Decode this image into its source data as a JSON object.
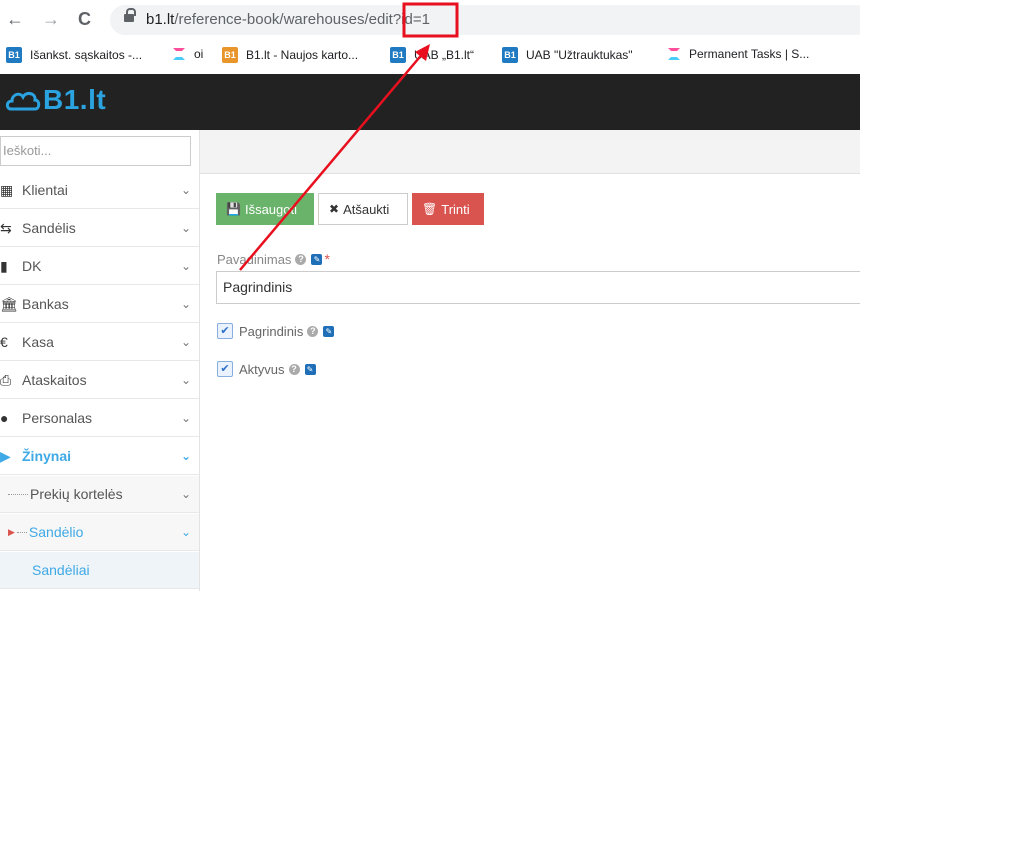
{
  "browser": {
    "back_icon": "←",
    "forward_icon": "→",
    "reload_icon": "C",
    "url_host": "b1.lt",
    "url_path": "/reference-book/warehouses/edit?id=1",
    "bookmarks": [
      {
        "icon": "b1-icon",
        "label": "Išankst. sąskaitos -..."
      },
      {
        "icon": "clickup-icon",
        "label": "oi"
      },
      {
        "icon": "b1-orange-icon",
        "label": "B1.lt - Naujos karto..."
      },
      {
        "icon": "b1-icon",
        "label": "UAB „B1.lt“"
      },
      {
        "icon": "b1-icon",
        "label": "UAB \"Užtrauktukas\""
      },
      {
        "icon": "clickup-icon",
        "label": "Permanent Tasks | S..."
      }
    ],
    "b1_fav_text": "B1"
  },
  "app": {
    "logo_text": "B1.lt",
    "header_bg": "#222222",
    "accent": "#2aa3e0"
  },
  "sidebar": {
    "search_placeholder": "Ieškoti...",
    "items": [
      {
        "label": "Klientai",
        "icon": "address-book-icon"
      },
      {
        "label": "Sandėlis",
        "icon": "exchange-icon"
      },
      {
        "label": "DK",
        "icon": "book-icon"
      },
      {
        "label": "Bankas",
        "icon": "bank-icon"
      },
      {
        "label": "Kasa",
        "icon": "euro-icon"
      },
      {
        "label": "Ataskaitos",
        "icon": "print-icon"
      },
      {
        "label": "Personalas",
        "icon": "users-icon"
      },
      {
        "label": "Žinynai",
        "icon": "folder-open-icon"
      },
      {
        "label": "Prekių kortelės"
      },
      {
        "label": "Sandėlio"
      },
      {
        "label": "Sandėliai"
      }
    ]
  },
  "form": {
    "save_label": "Išsaugoti",
    "cancel_label": "Atšaukti",
    "delete_label": "Trinti",
    "name_label": "Pavadinimas",
    "name_value": "Pagrindinis",
    "required_mark": "*",
    "checkbox_main_label": "Pagrindinis",
    "checkbox_active_label": "Aktyvus",
    "checkbox_main_checked": true,
    "checkbox_active_checked": true
  },
  "colors": {
    "save_btn": "#6ab36b",
    "delete_btn": "#d9534f",
    "annotation": "#e8101e"
  }
}
